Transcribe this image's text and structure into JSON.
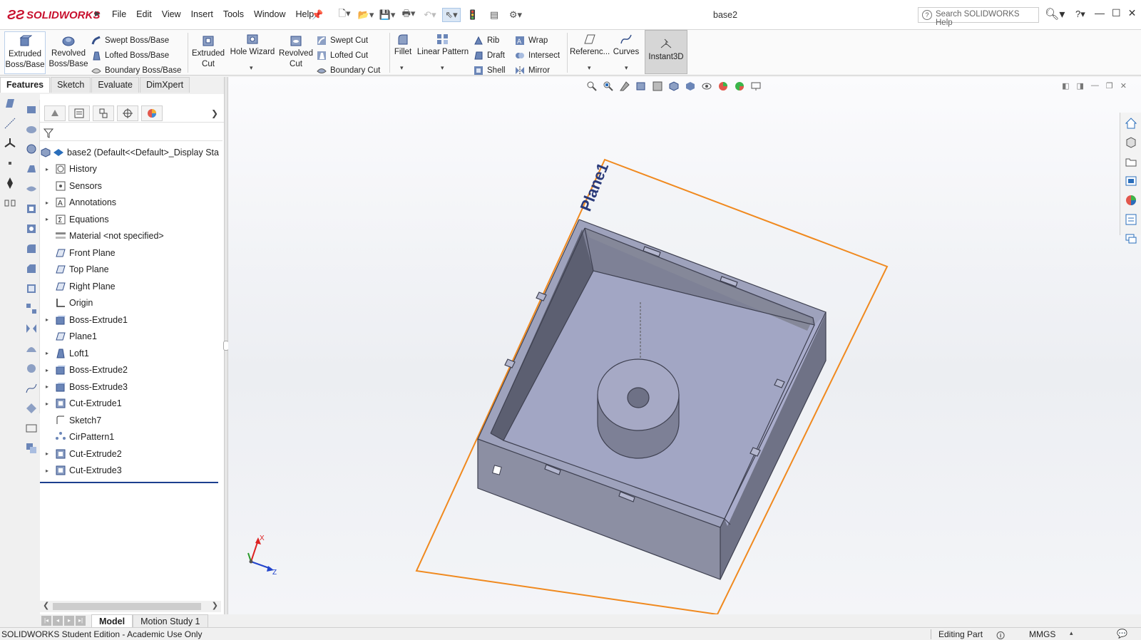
{
  "app": {
    "logo_text": "SOLIDWORKS",
    "document_title": "base2",
    "search_placeholder": "Search SOLIDWORKS Help"
  },
  "menu": [
    "File",
    "Edit",
    "View",
    "Insert",
    "Tools",
    "Window",
    "Help"
  ],
  "ribbon": {
    "extruded_boss": [
      "Extruded",
      "Boss/Base"
    ],
    "revolved_boss": [
      "Revolved",
      "Boss/Base"
    ],
    "swept_boss": "Swept Boss/Base",
    "lofted_boss": "Lofted Boss/Base",
    "boundary_boss": "Boundary Boss/Base",
    "extruded_cut": [
      "Extruded",
      "Cut"
    ],
    "hole_wizard": "Hole Wizard",
    "revolved_cut": [
      "Revolved",
      "Cut"
    ],
    "swept_cut": "Swept Cut",
    "lofted_cut": "Lofted Cut",
    "boundary_cut": "Boundary Cut",
    "fillet": "Fillet",
    "linear_pattern": "Linear Pattern",
    "rib": "Rib",
    "draft": "Draft",
    "shell": "Shell",
    "wrap": "Wrap",
    "intersect": "Intersect",
    "mirror": "Mirror",
    "reference": "Referenc...",
    "curves": "Curves",
    "instant3d": "Instant3D"
  },
  "tabs": [
    "Features",
    "Sketch",
    "Evaluate",
    "DimXpert"
  ],
  "tree": {
    "root": "base2  (Default<<Default>_Display Sta",
    "items": [
      {
        "label": "History",
        "expandable": true
      },
      {
        "label": "Sensors",
        "expandable": false
      },
      {
        "label": "Annotations",
        "expandable": true
      },
      {
        "label": "Equations",
        "expandable": true
      },
      {
        "label": "Material <not specified>",
        "expandable": false
      },
      {
        "label": "Front Plane",
        "expandable": false
      },
      {
        "label": "Top Plane",
        "expandable": false
      },
      {
        "label": "Right Plane",
        "expandable": false
      },
      {
        "label": "Origin",
        "expandable": false
      },
      {
        "label": "Boss-Extrude1",
        "expandable": true
      },
      {
        "label": "Plane1",
        "expandable": false
      },
      {
        "label": "Loft1",
        "expandable": true
      },
      {
        "label": "Boss-Extrude2",
        "expandable": true
      },
      {
        "label": "Boss-Extrude3",
        "expandable": true
      },
      {
        "label": "Cut-Extrude1",
        "expandable": true
      },
      {
        "label": "Sketch7",
        "expandable": false
      },
      {
        "label": "CirPattern1",
        "expandable": false
      },
      {
        "label": "Cut-Extrude2",
        "expandable": true
      },
      {
        "label": "Cut-Extrude3",
        "expandable": true
      }
    ]
  },
  "viewport": {
    "plane_label": "Plane1",
    "triad_x": "X",
    "triad_z": "Z"
  },
  "bottom_tabs": [
    "Model",
    "Motion Study 1"
  ],
  "status": {
    "left": "SOLIDWORKS Student Edition - Academic Use Only",
    "mode": "Editing Part",
    "units": "MMGS"
  },
  "colors": {
    "brand": "#c8102e",
    "plane": "#f0891e",
    "part": "#8f93a8",
    "selection": "#1c3f8f"
  }
}
